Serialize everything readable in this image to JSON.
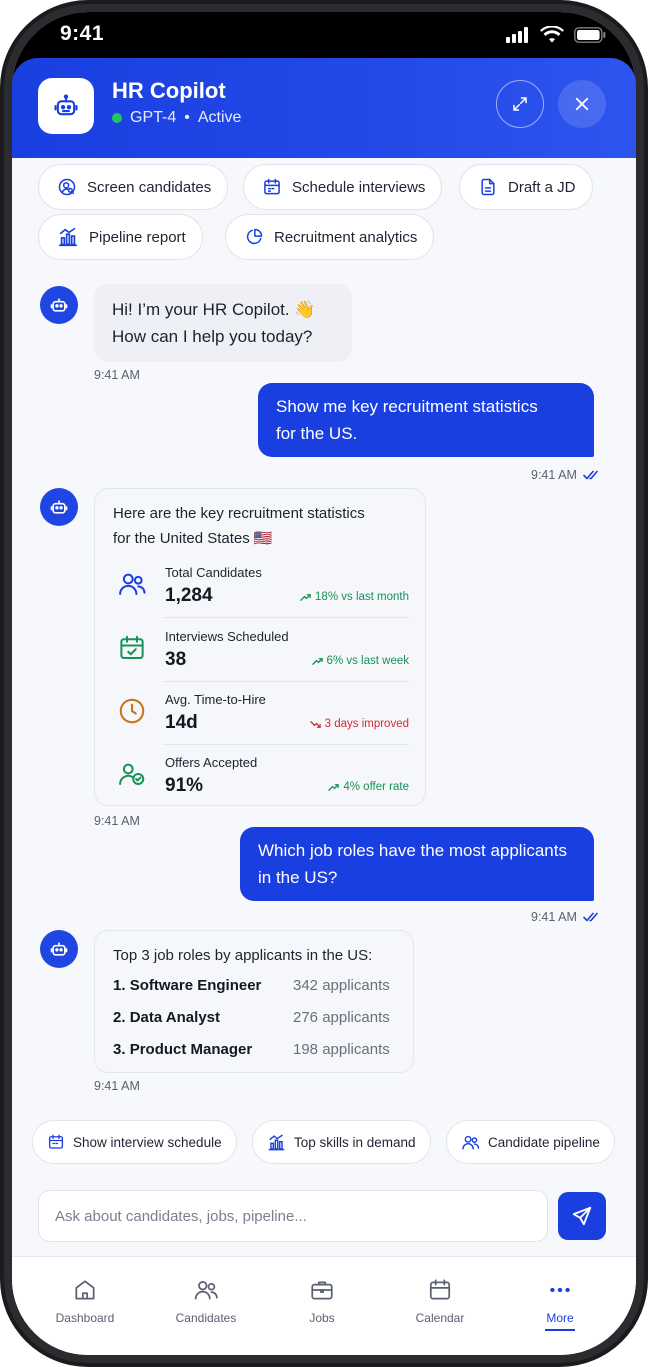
{
  "status": {
    "time": "9:41"
  },
  "header": {
    "title": "HR Copilot",
    "model": "GPT-4",
    "separator": "•",
    "state": "Active"
  },
  "suggestions": [
    {
      "label": "Screen candidates",
      "icon": "user-search-icon"
    },
    {
      "label": "Schedule interviews",
      "icon": "calendar-icon"
    },
    {
      "label": "Draft a JD",
      "icon": "document-icon"
    },
    {
      "label": "Pipeline report",
      "icon": "bar-chart-icon"
    },
    {
      "label": "Recruitment analytics",
      "icon": "pie-chart-icon"
    }
  ],
  "messages": {
    "greeting": {
      "line1": "Hi! I’m your HR Copilot. 👋",
      "line2": "How can I help you today?",
      "time": "9:41 AM"
    },
    "user1": {
      "line1": "Show me key recruitment statistics",
      "line2": "for the US.",
      "time": "9:41 AM"
    },
    "stats": {
      "intro1": "Here are the key recruitment statistics",
      "intro2": "for the United States 🇺🇸",
      "time": "9:41 AM",
      "items": [
        {
          "label": "Total Candidates",
          "value": "1,284",
          "trend": "18% vs last month",
          "direction": "up",
          "icon": "users-icon"
        },
        {
          "label": "Interviews Scheduled",
          "value": "38",
          "trend": "6% vs last week",
          "direction": "up",
          "icon": "calendar-check-icon"
        },
        {
          "label": "Avg. Time-to-Hire",
          "value": "14d",
          "trend": "3 days improved",
          "direction": "down",
          "icon": "clock-icon"
        },
        {
          "label": "Offers Accepted",
          "value": "91%",
          "trend": "4% offer rate",
          "direction": "up",
          "icon": "user-check-icon"
        }
      ]
    },
    "user2": {
      "line1": "Which job roles have the most applicants",
      "line2": "in the US?",
      "time": "9:41 AM"
    },
    "roles": {
      "intro": "Top 3 job roles by applicants in the US:",
      "time": "9:41 AM",
      "items": [
        {
          "rank": "1.",
          "name": "Software Engineer",
          "applicants": "342 applicants"
        },
        {
          "rank": "2.",
          "name": "Data Analyst",
          "applicants": "276 applicants"
        },
        {
          "rank": "3.",
          "name": "Product Manager",
          "applicants": "198 applicants"
        }
      ]
    }
  },
  "quick_replies": [
    {
      "label": "Show interview schedule",
      "icon": "calendar-icon"
    },
    {
      "label": "Top skills in demand",
      "icon": "bar-chart-icon"
    },
    {
      "label": "Candidate pipeline",
      "icon": "users-icon"
    }
  ],
  "composer": {
    "placeholder": "Ask about candidates, jobs, pipeline..."
  },
  "nav": [
    {
      "label": "Dashboard",
      "icon": "home-icon"
    },
    {
      "label": "Candidates",
      "icon": "users-icon"
    },
    {
      "label": "Jobs",
      "icon": "briefcase-icon"
    },
    {
      "label": "Calendar",
      "icon": "calendar-icon"
    },
    {
      "label": "More",
      "icon": "more-dots-icon",
      "active": true
    }
  ],
  "colors": {
    "primary": "#1a3fe0",
    "positive": "#17915a",
    "negative": "#d6282c",
    "online": "#22c55e"
  }
}
